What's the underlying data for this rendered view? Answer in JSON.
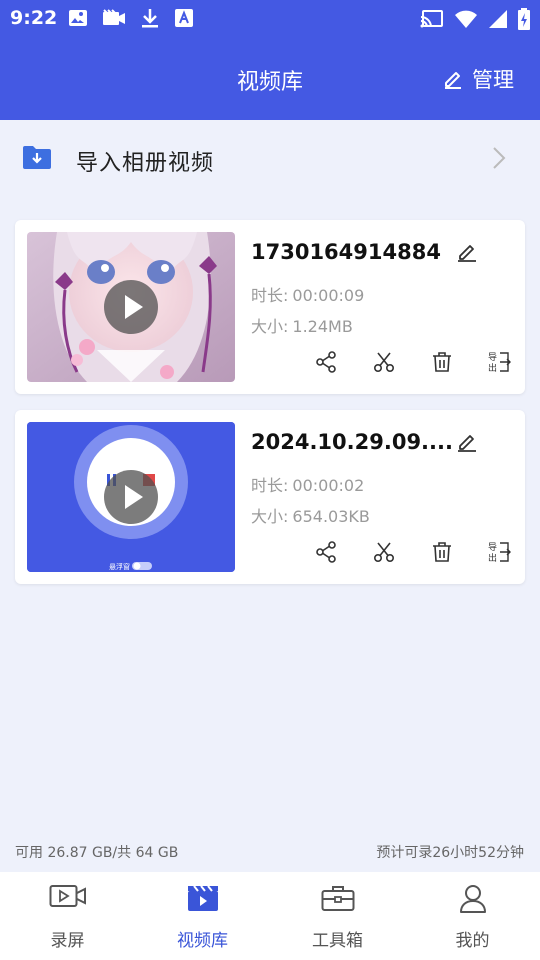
{
  "status_bar": {
    "time": "9:22",
    "left_icons": [
      "image-icon",
      "video-camera-icon",
      "download-icon",
      "font-icon"
    ],
    "right_icons": [
      "cast-icon",
      "wifi-icon",
      "signal-icon",
      "battery-charging-icon"
    ]
  },
  "app_bar": {
    "title": "视频库",
    "manage_label": "管理",
    "background": "#4459e3"
  },
  "import_row": {
    "label": "导入相册视频"
  },
  "videos": [
    {
      "name": "1730164914884",
      "duration_label": "时长:",
      "duration": "00:00:09",
      "size_label": "大小:",
      "size": "1.24MB",
      "thumbnail": "anime-girl"
    },
    {
      "name": "2024.10.29.09....",
      "duration_label": "时长:",
      "duration": "00:00:02",
      "size_label": "大小:",
      "size": "654.03KB",
      "thumbnail": "recorder-screen",
      "thumb_caption": "悬浮窗"
    }
  ],
  "storage": {
    "available": "可用 26.87 GB/共 64 GB",
    "estimate": "预计可录26小时52分钟"
  },
  "bottom_nav": {
    "active_color": "#3a55d8",
    "tabs": [
      {
        "label": "录屏",
        "icon": "screen-record-icon"
      },
      {
        "label": "视频库",
        "icon": "video-library-icon",
        "active": true
      },
      {
        "label": "工具箱",
        "icon": "toolbox-icon"
      },
      {
        "label": "我的",
        "icon": "profile-icon"
      }
    ]
  }
}
